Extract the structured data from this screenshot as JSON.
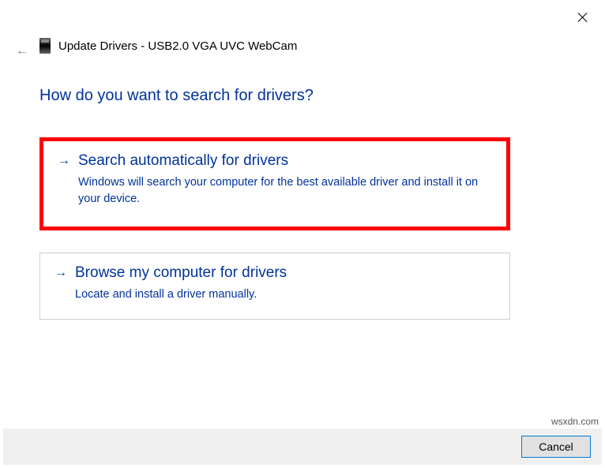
{
  "title": "Update Drivers - USB2.0 VGA UVC WebCam",
  "heading": "How do you want to search for drivers?",
  "options": [
    {
      "title": "Search automatically for drivers",
      "desc": "Windows will search your computer for the best available driver and install it on your device."
    },
    {
      "title": "Browse my computer for drivers",
      "desc": "Locate and install a driver manually."
    }
  ],
  "buttons": {
    "cancel": "Cancel"
  },
  "watermark": "wsxdn.com"
}
